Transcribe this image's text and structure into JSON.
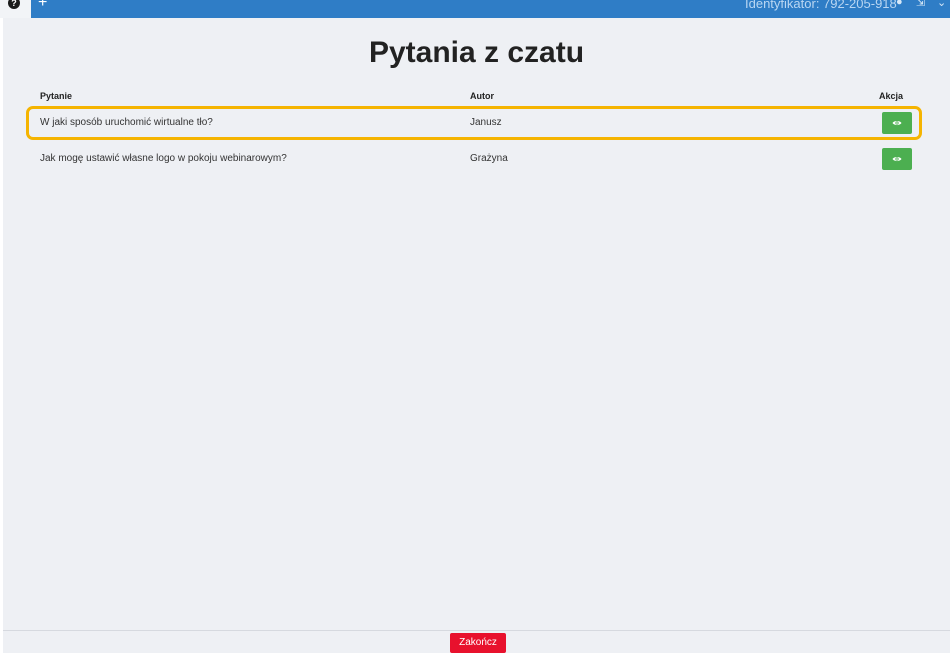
{
  "topbar": {
    "help_icon": "question-circle-icon",
    "add_icon": "plus-icon",
    "identifier_text": "Identyfikator: 792-205-918",
    "right_icons": [
      "speaker-icon",
      "expand-icon",
      "chevron-down-icon"
    ]
  },
  "page": {
    "title": "Pytania z czatu"
  },
  "table": {
    "columns": [
      "Pytanie",
      "Autor",
      "Akcja"
    ],
    "rows": [
      {
        "question": "W jaki sposób uruchomić wirtualne tło?",
        "author": "Janusz",
        "action_icon": "eye-icon",
        "highlighted": true
      },
      {
        "question": "Jak mogę ustawić własne logo w pokoju webinarowym?",
        "author": "Grażyna",
        "action_icon": "eye-icon",
        "highlighted": false
      }
    ]
  },
  "footer": {
    "finish_label": "Zakończ"
  },
  "colors": {
    "topbar": "#2f7dc6",
    "panel_bg": "#eef0f4",
    "action_button": "#4caf50",
    "finish_button": "#e8112d",
    "highlight": "#f5b400"
  }
}
